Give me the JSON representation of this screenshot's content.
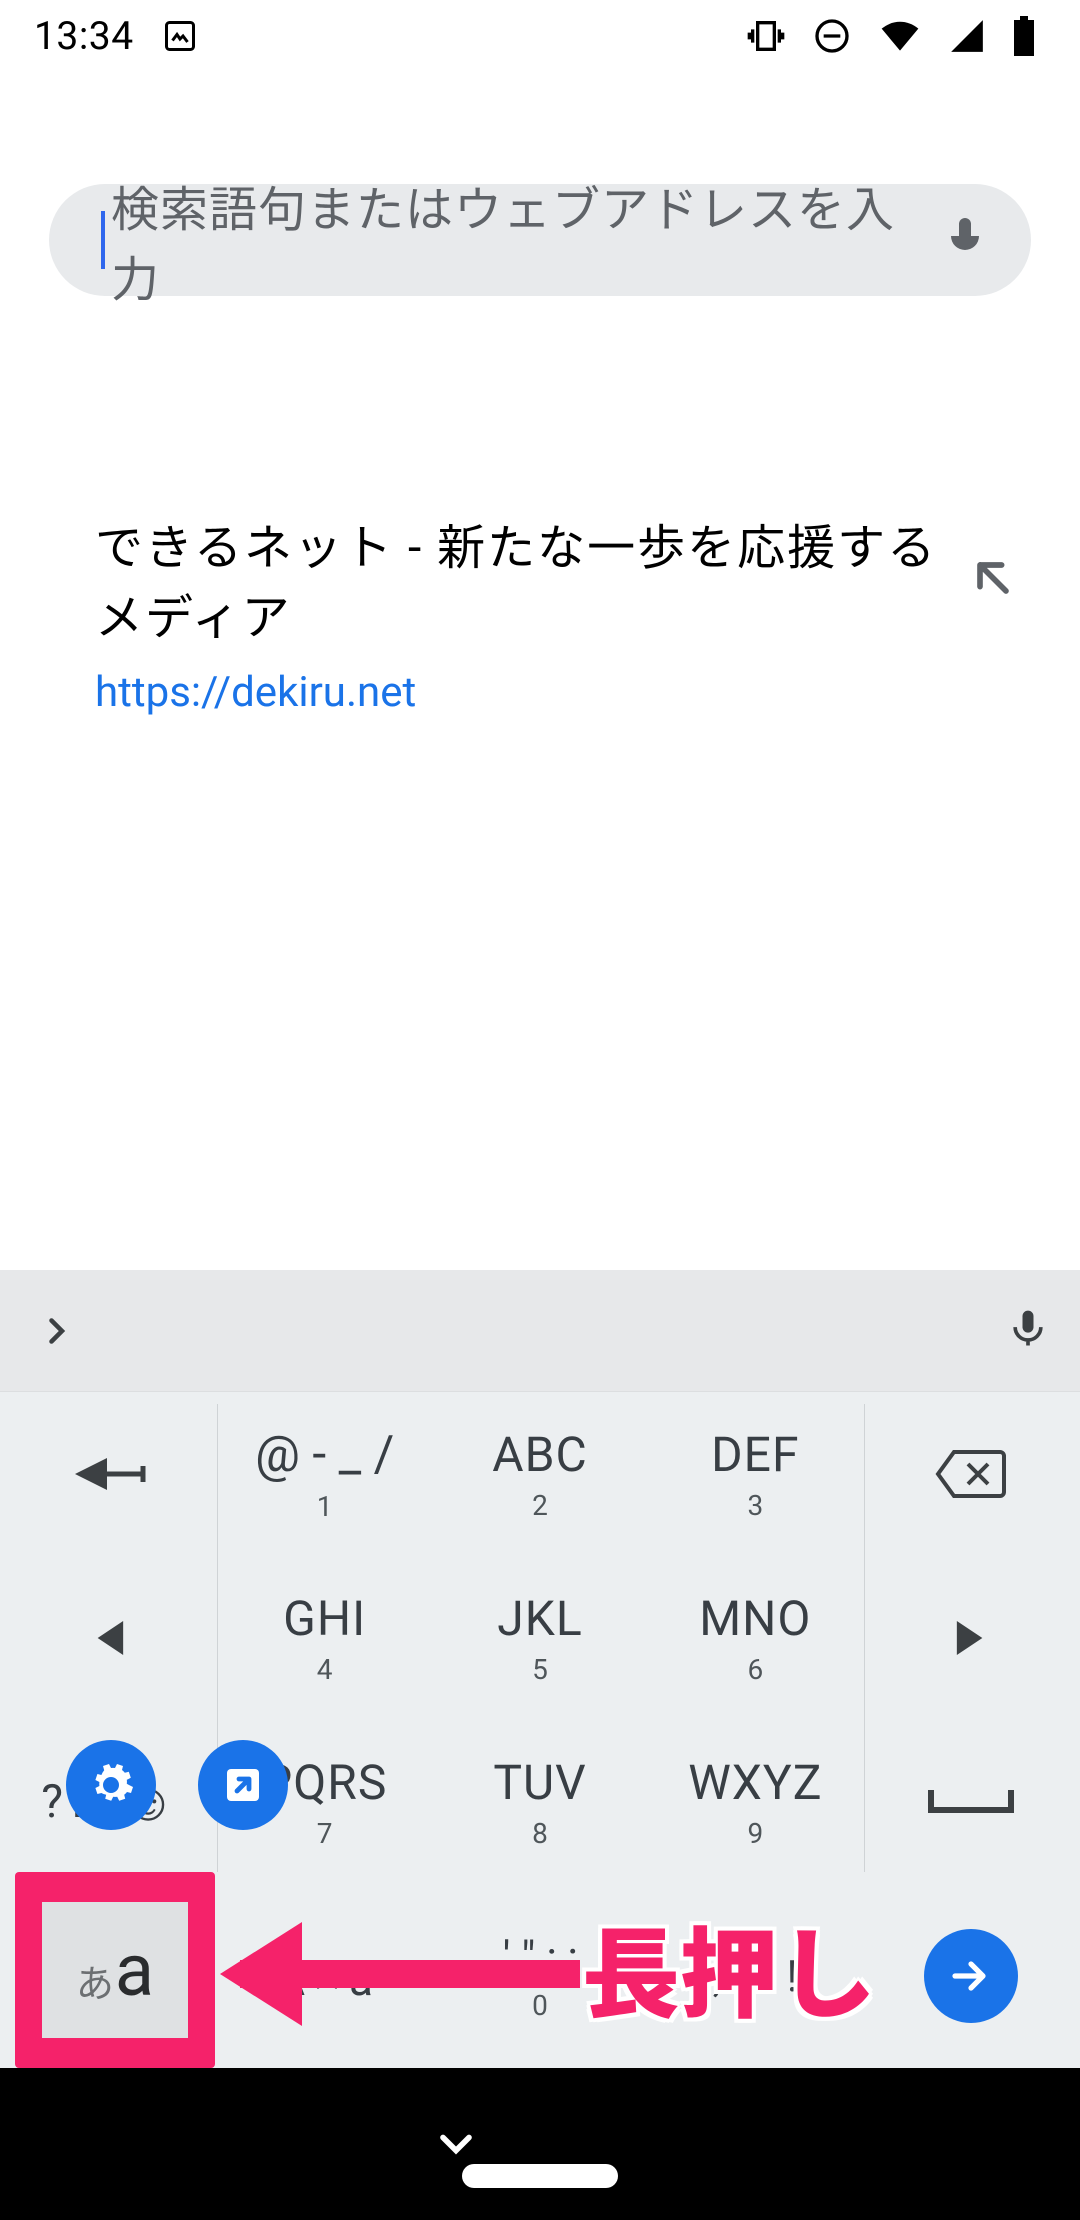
{
  "status": {
    "time": "13:34"
  },
  "omnibox": {
    "placeholder": "検索語句またはウェブアドレスを入力"
  },
  "suggestion": {
    "title": "できるネット - 新たな一歩を応援するメディア",
    "url": "https://dekiru.net"
  },
  "keyboard": {
    "rows": [
      [
        {
          "main": "",
          "icon": "arrow-left-bar"
        },
        {
          "main": "@ - _ /",
          "sub": "1"
        },
        {
          "main": "ABC",
          "sub": "2"
        },
        {
          "main": "DEF",
          "sub": "3"
        },
        {
          "main": "",
          "icon": "backspace"
        }
      ],
      [
        {
          "main": "",
          "icon": "tri-left"
        },
        {
          "main": "GHI",
          "sub": "4"
        },
        {
          "main": "JKL",
          "sub": "5"
        },
        {
          "main": "MNO",
          "sub": "6"
        },
        {
          "main": "",
          "icon": "tri-right"
        }
      ],
      [
        {
          "main": "?123☺",
          "sub": ""
        },
        {
          "main": "PQRS",
          "sub": "7"
        },
        {
          "main": "TUV",
          "sub": "8"
        },
        {
          "main": "WXYZ",
          "sub": "9"
        },
        {
          "main": "",
          "icon": "space"
        }
      ],
      [
        {
          "main": "",
          "icon": "lang"
        },
        {
          "main": "A↔a",
          "sub": ""
        },
        {
          "main": "' \" : ;",
          "sub": "0"
        },
        {
          "main": ", . ? !",
          "sub": ""
        },
        {
          "main": "",
          "icon": "enter"
        }
      ]
    ],
    "lang_key": {
      "small": "あ",
      "big": "a"
    }
  },
  "annotation": {
    "label": "長押し"
  }
}
